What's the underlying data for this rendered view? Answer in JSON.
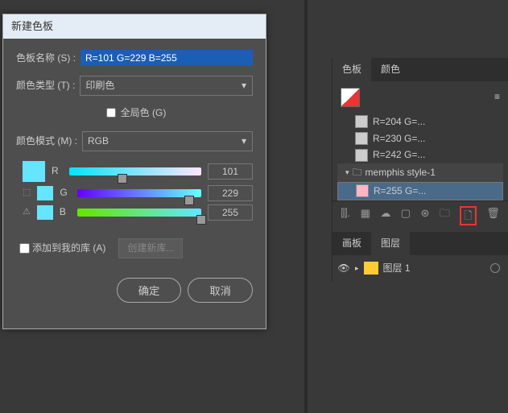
{
  "dialog": {
    "title": "新建色板",
    "name_label": "色板名称 (S) :",
    "name_value": "R=101 G=229 B=255",
    "type_label": "颜色类型 (T) :",
    "type_value": "印刷色",
    "global_label": "全局色 (G)",
    "mode_label": "颜色模式 (M) :",
    "mode_value": "RGB",
    "r_label": "R",
    "r_value": "101",
    "g_label": "G",
    "g_value": "229",
    "b_label": "B",
    "b_value": "255",
    "add_label": "添加到我的库 (A)",
    "newlib": "创建新库...",
    "ok": "确定",
    "cancel": "取消"
  },
  "panel": {
    "tabs": {
      "swatch": "色板",
      "color": "颜色"
    },
    "items": [
      {
        "label": "R=204 G=..."
      },
      {
        "label": "R=230 G=..."
      },
      {
        "label": "R=242 G=..."
      }
    ],
    "folder": "memphis style-1",
    "folder_item": "R=255 G=...",
    "tabs2": {
      "artboard": "画板",
      "layers": "图层"
    },
    "layer": "图层 1"
  }
}
